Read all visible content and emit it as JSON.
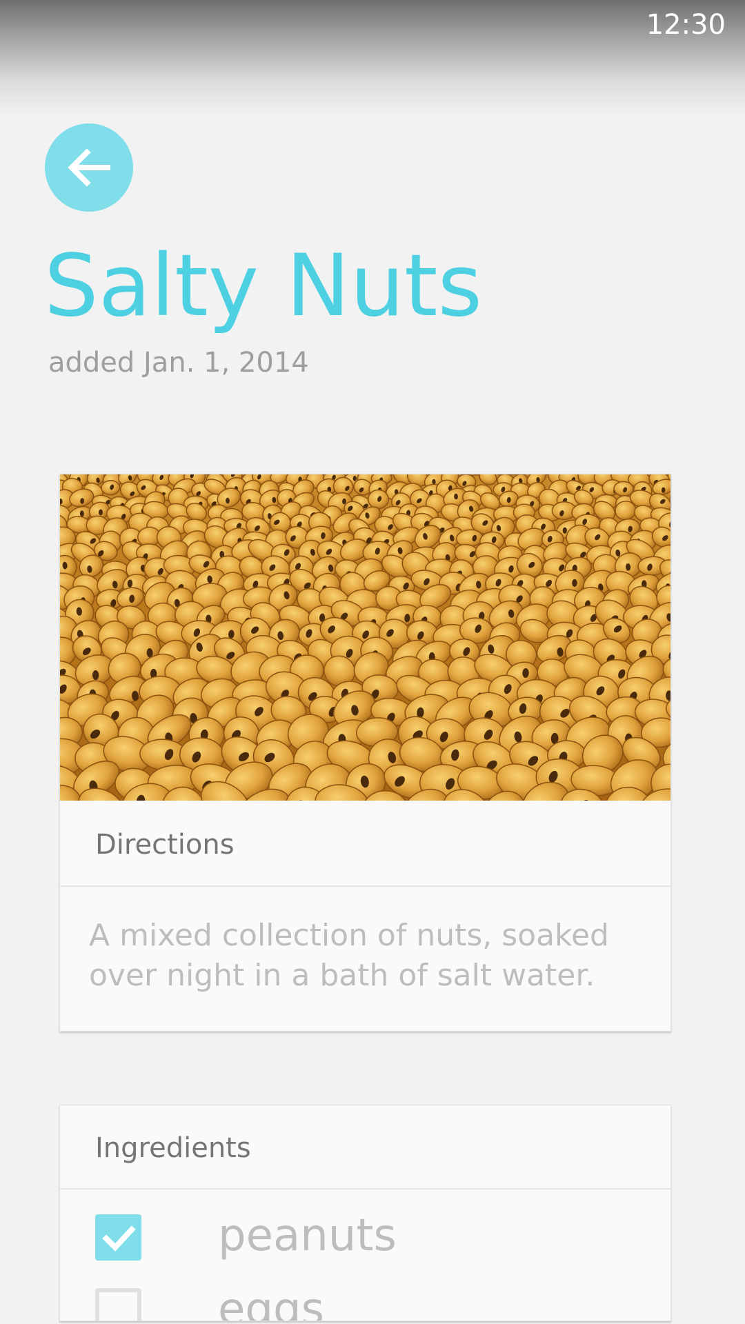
{
  "status_bar": {
    "time": "12:30"
  },
  "colors": {
    "accent": "#4dd0e1",
    "accent_light": "#80deea",
    "background": "#f2f2f2",
    "card": "#fafafa"
  },
  "header": {
    "back_icon": "arrow-left-icon",
    "title": "Salty Nuts",
    "subtitle": "added Jan. 1, 2014"
  },
  "directions_card": {
    "image_subject": "salty-roasted-corn-nuts",
    "header": "Directions",
    "body": "A mixed collection of nuts, soaked over night in a bath of salt water."
  },
  "ingredients_card": {
    "header": "Ingredients",
    "items": [
      {
        "label": "peanuts",
        "checked": true
      },
      {
        "label": "eggs",
        "checked": false
      }
    ]
  }
}
